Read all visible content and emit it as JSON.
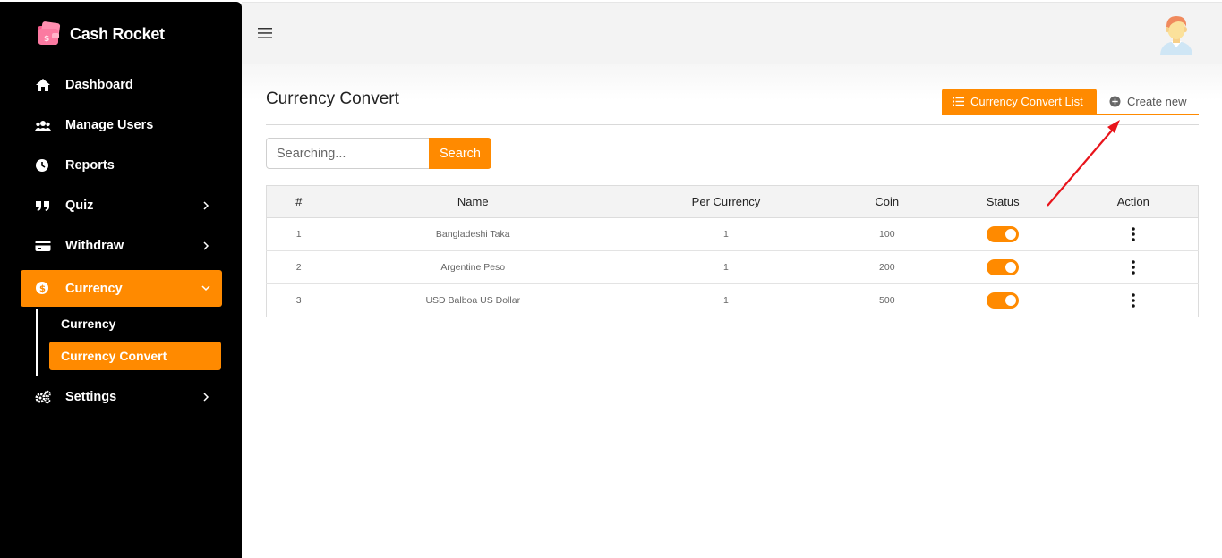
{
  "brand": {
    "name": "Cash Rocket",
    "accent": "#ff8a00"
  },
  "sidebar": {
    "items": [
      {
        "label": "Dashboard",
        "icon": "home-icon"
      },
      {
        "label": "Manage Users",
        "icon": "users-icon"
      },
      {
        "label": "Reports",
        "icon": "clock-icon"
      },
      {
        "label": "Quiz",
        "icon": "quote-icon"
      },
      {
        "label": "Withdraw",
        "icon": "credit-card-icon"
      },
      {
        "label": "Currency",
        "icon": "dollar-circle-icon",
        "expanded": true
      },
      {
        "label": "Settings",
        "icon": "cogs-icon"
      }
    ],
    "currency_sub": [
      {
        "label": "Currency"
      },
      {
        "label": "Currency Convert",
        "active": true
      }
    ]
  },
  "main": {
    "title": "Currency Convert",
    "tabs": {
      "list_label": "Currency Convert List",
      "create_label": "Create new"
    },
    "search": {
      "placeholder": "Searching...",
      "button_label": "Search"
    },
    "table": {
      "headers": [
        "#",
        "Name",
        "Per Currency",
        "Coin",
        "Status",
        "Action"
      ],
      "rows": [
        {
          "id": "1",
          "name": "Bangladeshi Taka",
          "per_currency": "1",
          "coin": "100",
          "status": true
        },
        {
          "id": "2",
          "name": "Argentine Peso",
          "per_currency": "1",
          "coin": "200",
          "status": true
        },
        {
          "id": "3",
          "name": "USD Balboa US Dollar",
          "per_currency": "1",
          "coin": "500",
          "status": true
        }
      ]
    }
  }
}
